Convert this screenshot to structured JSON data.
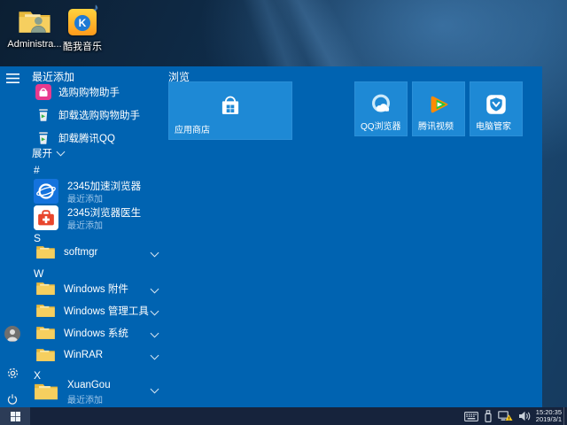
{
  "desktop": {
    "icons": [
      {
        "label": "Administra...",
        "kind": "user-folder"
      },
      {
        "label": "酷我音乐",
        "kind": "kuwo-music",
        "logo_letter": "K"
      }
    ]
  },
  "start_menu": {
    "recent_header": "最近添加",
    "recent": [
      {
        "label": "选购购物助手",
        "icon": "shopping-assistant-icon"
      },
      {
        "label": "卸载选购购物助手",
        "icon": "uninstall-trash-icon"
      },
      {
        "label": "卸载腾讯QQ",
        "icon": "uninstall-trash-icon"
      }
    ],
    "expand_label": "展开",
    "letters": [
      "#",
      "S",
      "W",
      "X"
    ],
    "apps": {
      "browser2345": {
        "title": "2345加速浏览器",
        "subtitle": "最近添加"
      },
      "doctor2345": {
        "title": "2345浏览器医生",
        "subtitle": "最近添加"
      },
      "softmgr": {
        "title": "softmgr"
      },
      "win_accessories": {
        "title": "Windows 附件"
      },
      "win_admin": {
        "title": "Windows 管理工具"
      },
      "win_system": {
        "title": "Windows 系统"
      },
      "winrar": {
        "title": "WinRAR"
      },
      "xuangou": {
        "title": "XuanGou",
        "subtitle": "最近添加"
      }
    },
    "tiles": {
      "group_header": "浏览",
      "store": {
        "label": "应用商店"
      },
      "qq_browser": {
        "label": "QQ浏览器"
      },
      "tencent_video": {
        "label": "腾讯视频"
      },
      "pc_manager": {
        "label": "电脑管家"
      }
    }
  },
  "taskbar": {
    "time": "15:20:35",
    "date": "2019/3/1"
  },
  "colors": {
    "menu_bg": "#0063b1",
    "tile_bg": "#1e89d5",
    "taskbar_bg": "#16233c",
    "subtitle_text": "#9cc5e8",
    "assistant_magenta": "#e83a8e",
    "warning_yellow": "#f6c51e"
  }
}
